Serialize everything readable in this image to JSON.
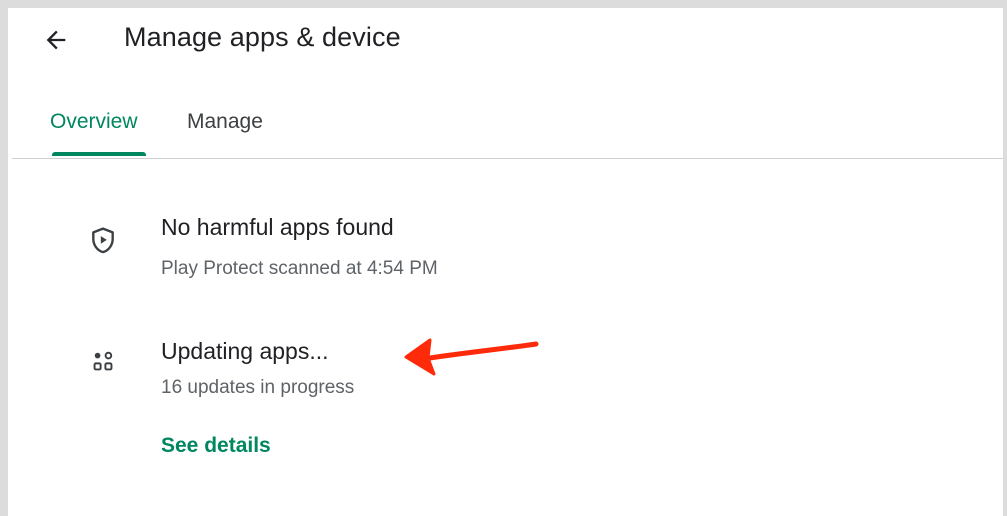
{
  "header": {
    "title": "Manage apps & device",
    "back_icon": "arrow-back-icon"
  },
  "tabs": [
    {
      "label": "Overview",
      "selected": true
    },
    {
      "label": "Manage",
      "selected": false
    }
  ],
  "protect": {
    "icon": "shield-play-icon",
    "title": "No harmful apps found",
    "subtitle": "Play Protect scanned at 4:54 PM"
  },
  "updates": {
    "icon": "apps-grid-icon",
    "title": "Updating apps...",
    "subtitle": "16 updates in progress",
    "link": "See details"
  },
  "annotation": {
    "icon": "red-arrow-icon",
    "color": "#ff2a0a"
  },
  "colors": {
    "accent": "#01875f",
    "text_primary": "#202124",
    "text_secondary": "#5f6368"
  }
}
